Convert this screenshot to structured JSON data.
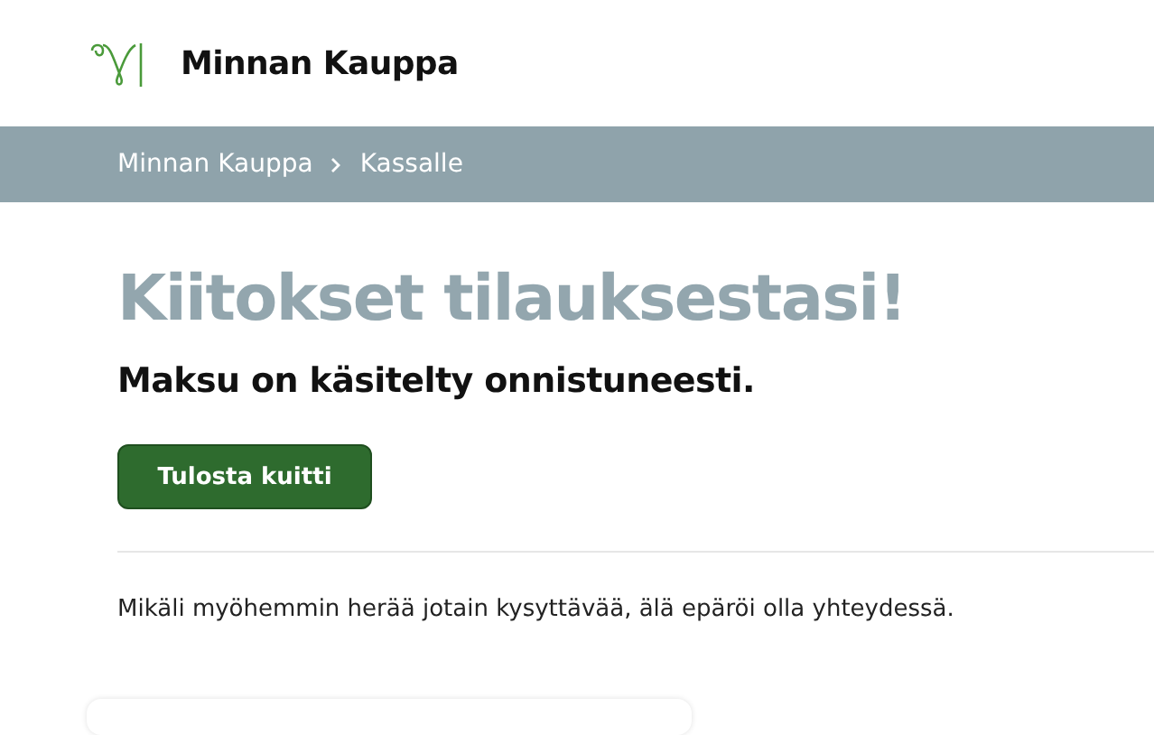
{
  "header": {
    "store_name": "Minnan Kauppa"
  },
  "breadcrumb": [
    {
      "label": "Minnan Kauppa"
    },
    {
      "label": "Kassalle"
    }
  ],
  "heading": "Kiitokset tilauksestasi!",
  "subheading": "Maksu on käsitelty onnistuneesti.",
  "print_button": "Tulosta kuitti",
  "note": "Mikäli myöhemmin herää jotain kysyttävää, älä epäröi olla yhteydessä."
}
